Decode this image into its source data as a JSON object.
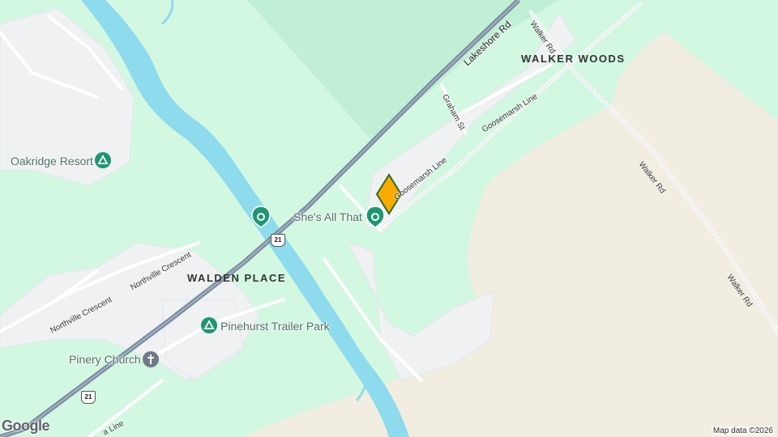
{
  "map": {
    "areas": {
      "walker_woods": "WALKER WOODS",
      "walden_place": "WALDEN PLACE"
    },
    "pois": {
      "oakridge": "Oakridge Resort",
      "shes_all_that": "She's All That",
      "pinehurst": "Pinehurst Trailer Park",
      "pinery_church": "Pinery Church"
    },
    "roads": {
      "lakeshore": "Lakeshore Rd",
      "walker_rd": "Walker Rd",
      "goosemarsh_line": "Goosemarsh Line",
      "graham_st": "Graham St",
      "northville_crescent": "Northville Crescent",
      "line_partial": "a Line"
    },
    "highway_shield": "21",
    "logo": "Google",
    "attribution": "Map data ©2026",
    "colors": {
      "forest": "#d3f8e2",
      "dark_forest": "#c1efd6",
      "sand": "#f1ede0",
      "water": "#8ddbec",
      "developed": "#eff1f3",
      "highway": "#7d8ea3",
      "poi_green": "#1e9672",
      "marker": "#f9ab00"
    },
    "icons": [
      "campground-icon",
      "place-icon",
      "church-icon",
      "location-marker-icon",
      "highway-shield-icon"
    ]
  }
}
